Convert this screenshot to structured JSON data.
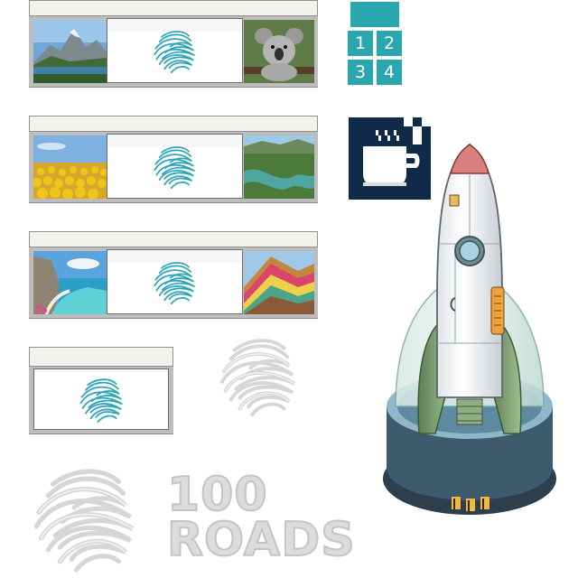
{
  "grid_icon": {
    "cells": [
      "1",
      "2",
      "3",
      "4"
    ],
    "color": "#2aa7ad"
  },
  "logo": {
    "line1": "100",
    "line2": "ROADS",
    "color": "#dcdcdc"
  },
  "icons": {
    "fingerprint": "fingerprint-logo-icon",
    "coffee": "coffee-cup-icon",
    "rocket": "rocket-icon"
  }
}
